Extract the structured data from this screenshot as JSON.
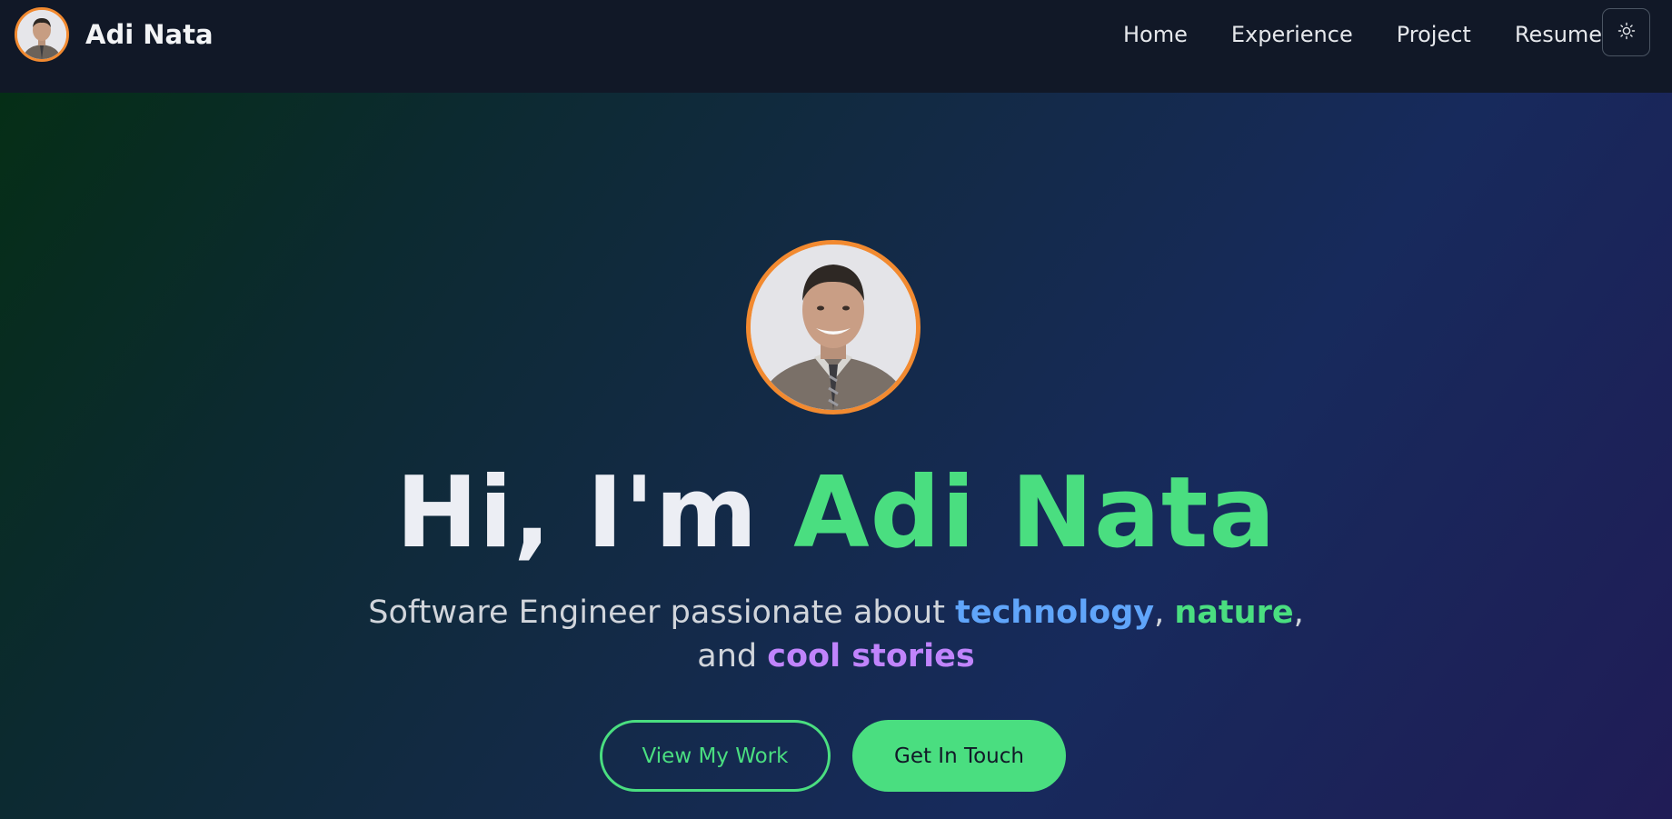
{
  "navbar": {
    "brand_name": "Adi Nata",
    "brand_avatar_alt": "Adi Nata profile photo",
    "links": [
      {
        "label": "Home"
      },
      {
        "label": "Experience"
      },
      {
        "label": "Project"
      },
      {
        "label": "Resume"
      }
    ],
    "theme_toggle_icon": "sun-icon"
  },
  "hero": {
    "greeting": "Hi, I'm",
    "name": "Adi Nata",
    "subtitle_prefix": "Software Engineer passionate about",
    "keyword_1": "technology",
    "separator_1": ",",
    "keyword_2": "nature",
    "separator_2": ", and",
    "keyword_3": "cool stories",
    "primary_button": "View My Work",
    "secondary_button": "Get In Touch"
  },
  "colors": {
    "accent_green": "#4ade80",
    "avatar_ring": "#f28a30",
    "keyword_blue": "#60a5fa",
    "keyword_purple": "#c084fc",
    "navbar_bg": "#111827"
  }
}
